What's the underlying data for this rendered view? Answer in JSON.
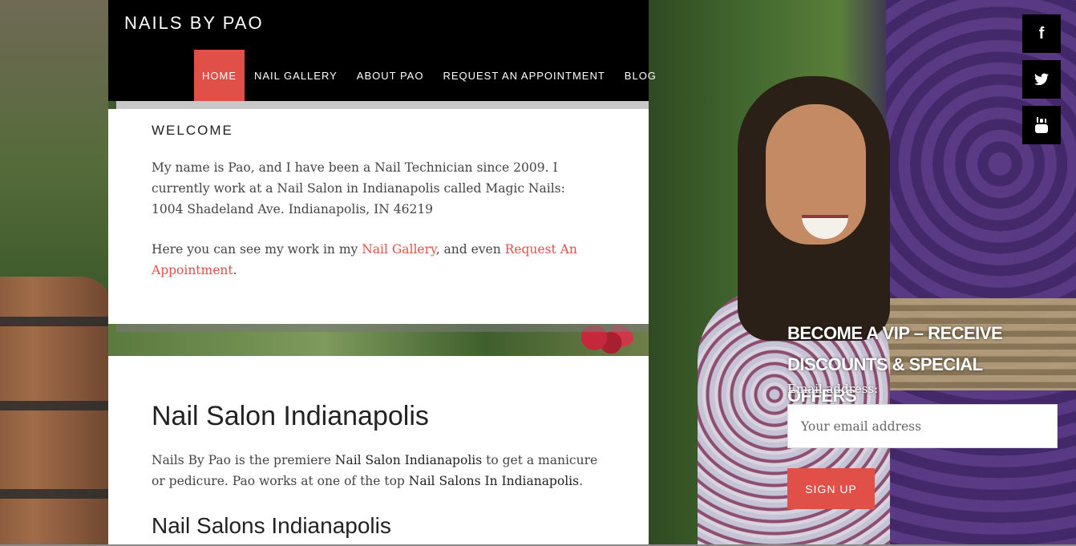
{
  "site": {
    "title": "NAILS BY PAO"
  },
  "nav": {
    "items": [
      {
        "label": "HOME",
        "active": true
      },
      {
        "label": "NAIL GALLERY",
        "active": false
      },
      {
        "label": "ABOUT PAO",
        "active": false
      },
      {
        "label": "REQUEST AN APPOINTMENT",
        "active": false
      },
      {
        "label": "BLOG",
        "active": false
      }
    ]
  },
  "welcome": {
    "heading": "WELCOME",
    "para1_line1": "My name is Pao, and I have been a Nail Technician since 2009. I currently work at a Nail Salon in Indianapolis called Magic Nails:",
    "para1_line2": "1004 Shadeland Ave. Indianapolis, IN 46219",
    "para2_prefix": "Here you can see my work in my ",
    "para2_link1": "Nail Gallery",
    "para2_middle": ", and even ",
    "para2_link2": "Request An Appointment",
    "para2_suffix": "."
  },
  "main": {
    "heading": "Nail Salon Indianapolis",
    "para_prefix": "Nails By Pao is the premiere ",
    "para_bold1": "Nail Salon Indianapolis",
    "para_middle": " to get a manicure or pedicure. Pao works at one of the top ",
    "para_bold2": "Nail Salons In Indianapolis",
    "para_suffix": ".",
    "subheading": "Nail Salons Indianapolis"
  },
  "social": {
    "facebook_glyph": "f",
    "twitter_glyph": "🐦",
    "youtube_glyph": "You"
  },
  "vip": {
    "title": "BECOME A VIP – RECEIVE DISCOUNTS & SPECIAL OFFERS",
    "email_label": "Email address:",
    "email_placeholder": "Your email address",
    "signup_label": "SIGN UP"
  },
  "colors": {
    "accent": "#e05049",
    "header_bg": "#000000"
  }
}
